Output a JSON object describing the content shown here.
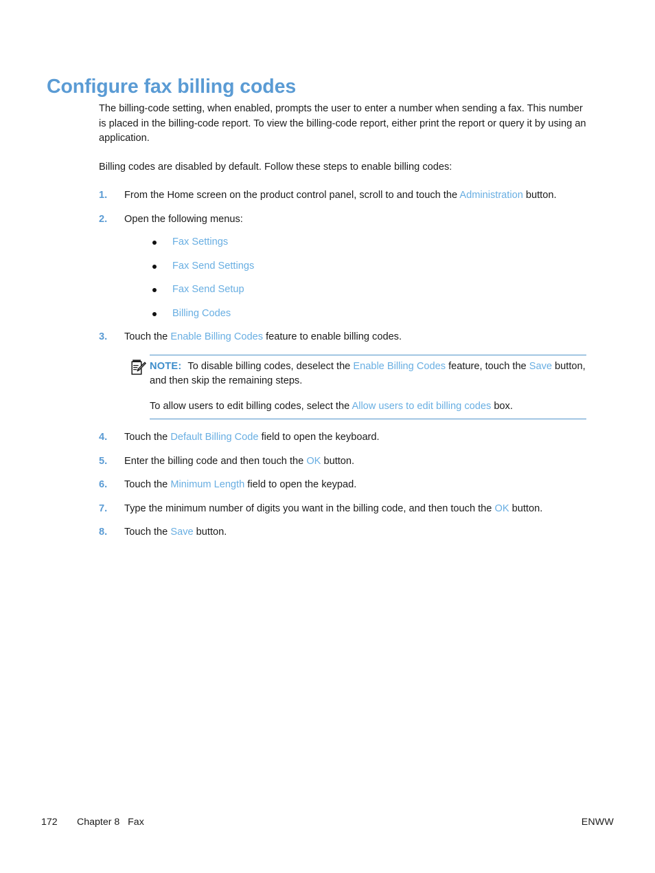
{
  "document": {
    "title": "Configure fax billing codes",
    "title_color": "#5a9bd4",
    "ui_term_color": "#68aee2"
  },
  "intro": {
    "paragraph_1": "The billing-code setting, when enabled, prompts the user to enter a number when sending a fax. This number is placed in the billing-code report. To view the billing-code report, either print the report or query it by using an application.",
    "paragraph_2": "Billing codes are disabled by default. Follow these steps to enable billing codes:"
  },
  "steps": [
    {
      "number": "1.",
      "text_before": "From the Home screen on the product control panel, scroll to and touch the ",
      "ui_term": "Administration",
      "text_after": " button."
    },
    {
      "number": "2.",
      "text_before": "Open the following menus:",
      "ui_term": "",
      "text_after": ""
    },
    {
      "number": "3.",
      "text_before": "Touch the ",
      "ui_term": "Enable Billing Codes",
      "text_after": " feature to enable billing codes."
    },
    {
      "number": "4.",
      "text_before": "Touch the ",
      "ui_term": "Default Billing Code",
      "text_after": " field to open the keyboard."
    },
    {
      "number": "5.",
      "text_before": "Enter the billing code and then touch the ",
      "ui_term": "OK",
      "text_after": " button."
    },
    {
      "number": "6.",
      "text_before": "Touch the ",
      "ui_term": "Minimum Length",
      "text_after": " field to open the keypad."
    },
    {
      "number": "7.",
      "text_before": "Type the minimum number of digits you want in the billing code, and then touch the ",
      "ui_term": "OK",
      "text_after": " button."
    },
    {
      "number": "8.",
      "text_before": "Touch the ",
      "ui_term": "Save",
      "text_after": " button."
    }
  ],
  "menu_bullets": [
    "Fax Settings",
    "Fax Send Settings",
    "Fax Send Setup",
    "Billing Codes"
  ],
  "note": {
    "icon": "note-pencil-icon",
    "label": "NOTE:",
    "line1_part1": "To disable billing codes, deselect the ",
    "line1_term1": "Enable Billing Codes",
    "line1_part2": " feature, touch the ",
    "line1_term2": "Save",
    "line1_part3": " button, and then skip the remaining steps.",
    "line2_part1": "To allow users to edit billing codes, select the ",
    "line2_term1": "Allow users to edit billing codes",
    "line2_part2": " box."
  },
  "footer": {
    "page_number": "172",
    "chapter": "Chapter 8   Fax",
    "right_label": "ENWW"
  }
}
